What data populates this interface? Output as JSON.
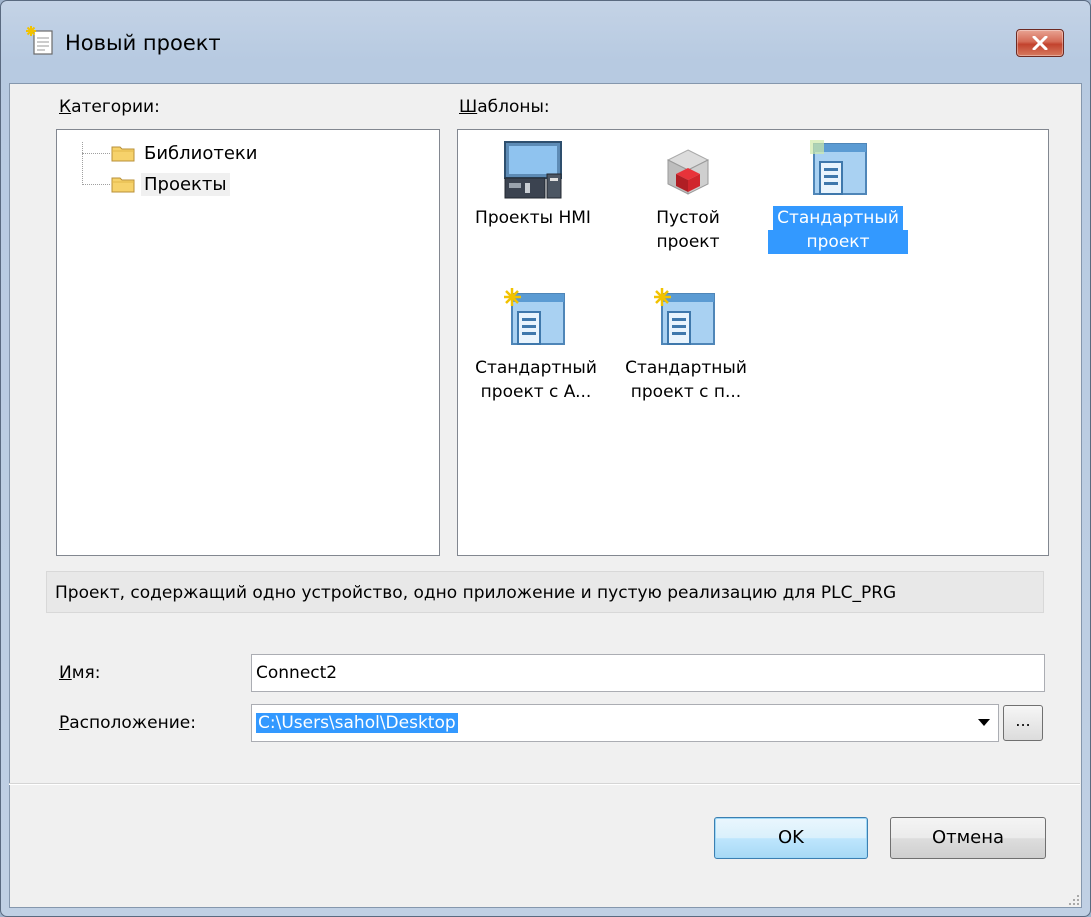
{
  "window": {
    "title": "Новый проект"
  },
  "categories": {
    "label_accel": "К",
    "label_rest": "атегории:",
    "items": [
      {
        "label": "Библиотеки",
        "selected": false
      },
      {
        "label": "Проекты",
        "selected": true
      }
    ]
  },
  "templates": {
    "label_accel": "Ш",
    "label_rest": "аблоны:",
    "items": [
      {
        "line1": "Проекты HMI",
        "line2": "",
        "icon": "hmi-project-icon",
        "selected": false
      },
      {
        "line1": "Пустой",
        "line2": "проект",
        "icon": "empty-project-icon",
        "selected": false
      },
      {
        "line1": "Стандартный",
        "line2": "проект",
        "icon": "standard-project-icon",
        "selected": true
      },
      {
        "line1": "Стандартный",
        "line2": "проект с A...",
        "icon": "standard-project-icon",
        "selected": false
      },
      {
        "line1": "Стандартный",
        "line2": "проект с п...",
        "icon": "standard-project-icon",
        "selected": false
      }
    ]
  },
  "description": "Проект, содержащий одно устройство, одно приложение и пустую реализацию для PLC_PRG",
  "form": {
    "name_label_accel": "И",
    "name_label_rest": "мя:",
    "name_value": "Connect2",
    "location_label_accel": "Р",
    "location_label_rest": "асположение:",
    "location_value": "C:\\Users\\sahol\\Desktop",
    "browse_label": "..."
  },
  "buttons": {
    "ok": "OK",
    "cancel": "Отмена"
  },
  "colors": {
    "selection": "#3399ff",
    "close_button": "#c2432e"
  }
}
